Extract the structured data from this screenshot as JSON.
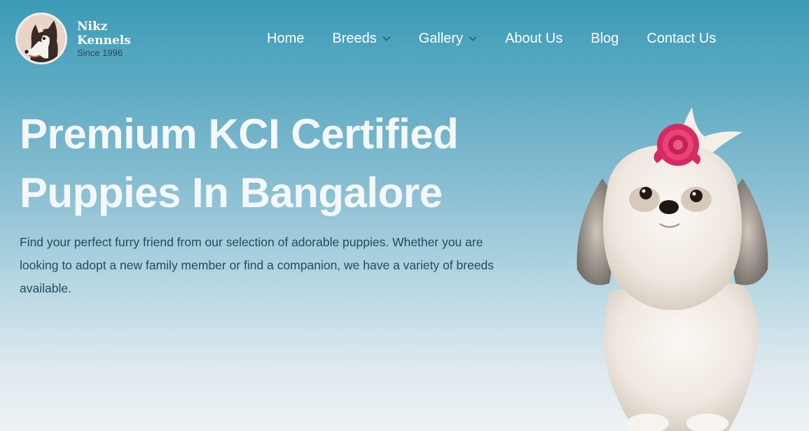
{
  "brand": {
    "name_line1": "Nikz",
    "name_line2": "Kennels",
    "since": "Since 1996",
    "logo_icon": "husky-icon"
  },
  "nav": {
    "items": [
      {
        "label": "Home",
        "has_dropdown": false
      },
      {
        "label": "Breeds",
        "has_dropdown": true
      },
      {
        "label": "Gallery",
        "has_dropdown": true
      },
      {
        "label": "About Us",
        "has_dropdown": false
      },
      {
        "label": "Blog",
        "has_dropdown": false
      },
      {
        "label": "Contact Us",
        "has_dropdown": false
      }
    ]
  },
  "hero": {
    "title_line1": "Premium KCI Certified",
    "title_line2": "Puppies In Bangalore",
    "description": "Find your perfect furry friend from our selection of adorable puppies. Whether you are looking to adopt a new family member or find a companion, we have a variety of breeds available.",
    "image": "shih-tzu-puppy-with-pink-flower"
  },
  "colors": {
    "header_teal": "#3b9bb6",
    "text_dark": "#1f4d5e",
    "flower_pink": "#e0336b"
  }
}
